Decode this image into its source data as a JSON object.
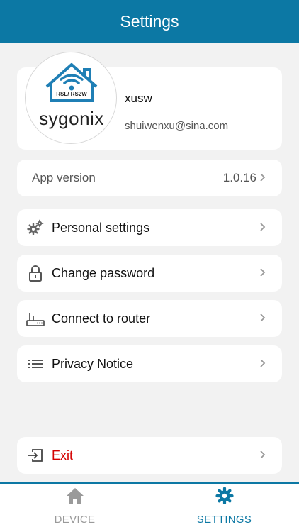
{
  "header": {
    "title": "Settings"
  },
  "profile": {
    "logo_model": "RSL/ RS2W",
    "logo_brand": "sygonix",
    "username": "xusw",
    "email": "shuiwenxu@sina.com"
  },
  "version": {
    "label": "App version",
    "value": "1.0.16"
  },
  "menu": {
    "personal": {
      "label": "Personal settings",
      "icon": "gears-icon"
    },
    "password": {
      "label": "Change password",
      "icon": "lock-icon"
    },
    "router": {
      "label": "Connect to router",
      "icon": "router-icon"
    },
    "privacy": {
      "label": "Privacy Notice",
      "icon": "list-icon"
    },
    "exit": {
      "label": "Exit",
      "icon": "exit-icon"
    }
  },
  "tabs": {
    "device": {
      "label": "DEVICE",
      "icon": "home-icon",
      "active": false
    },
    "settings": {
      "label": "SETTINGS",
      "icon": "gear-icon",
      "active": true
    }
  },
  "colors": {
    "accent": "#0c78a4",
    "exit": "#d40000",
    "inactive": "#9a9a9a",
    "background": "#f2f2f2"
  }
}
